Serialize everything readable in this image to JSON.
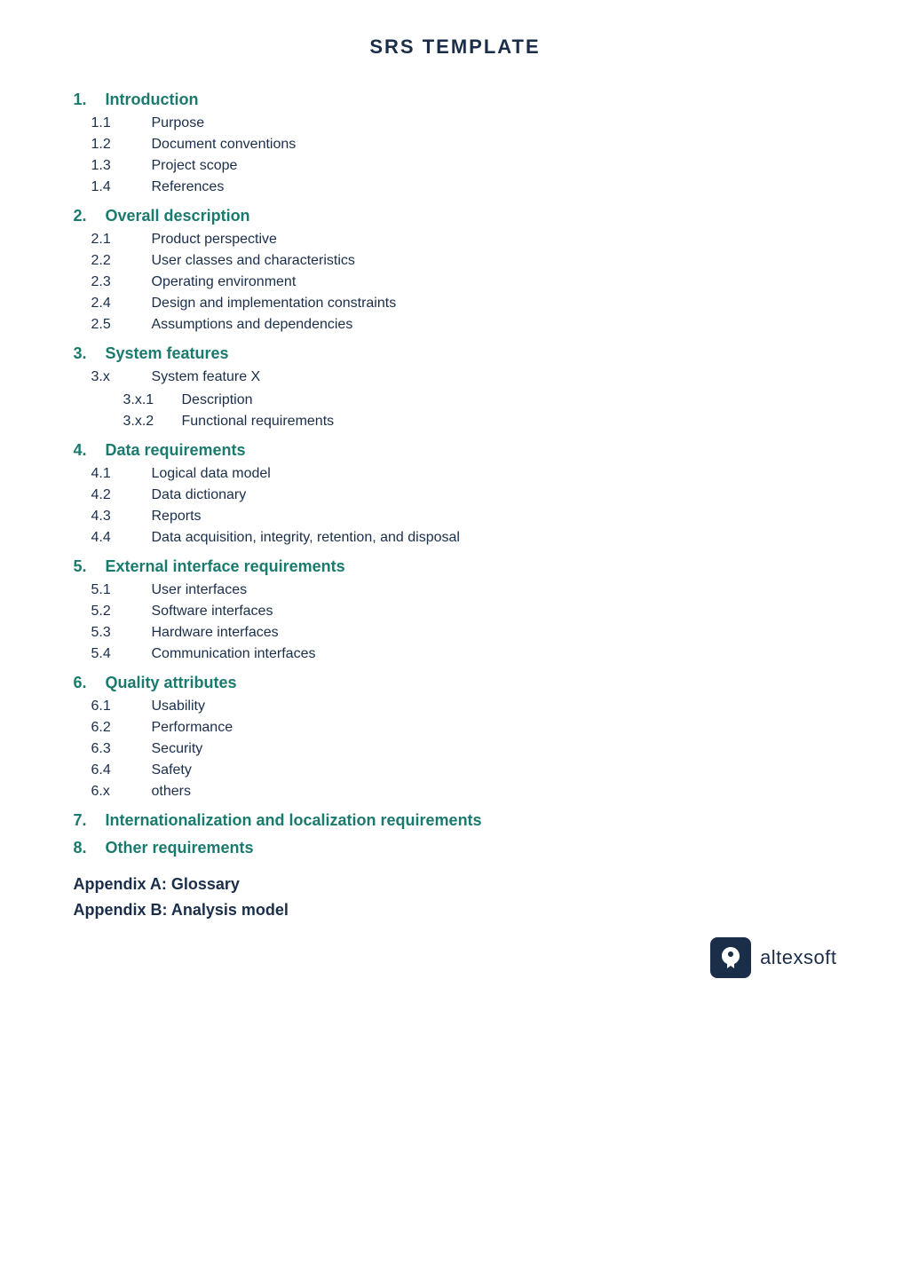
{
  "page": {
    "title": "SRS TEMPLATE"
  },
  "sections": [
    {
      "id": "s1",
      "number": "1.",
      "title": "Introduction",
      "items": [
        {
          "number": "1.1",
          "label": "Purpose"
        },
        {
          "number": "1.2",
          "label": "Document conventions"
        },
        {
          "number": "1.3",
          "label": "Project scope"
        },
        {
          "number": "1.4",
          "label": "References"
        }
      ],
      "subitems": []
    },
    {
      "id": "s2",
      "number": "2.",
      "title": "Overall description",
      "items": [
        {
          "number": "2.1",
          "label": "Product perspective"
        },
        {
          "number": "2.2",
          "label": "User classes and characteristics"
        },
        {
          "number": "2.3",
          "label": "Operating environment"
        },
        {
          "number": "2.4",
          "label": "Design and implementation constraints"
        },
        {
          "number": "2.5",
          "label": "Assumptions and dependencies"
        }
      ],
      "subitems": []
    },
    {
      "id": "s3",
      "number": "3.",
      "title": "System features",
      "items": [
        {
          "number": "3.x",
          "label": "System feature X"
        }
      ],
      "subitems": [
        {
          "number": "3.x.1",
          "label": "Description"
        },
        {
          "number": "3.x.2",
          "label": "Functional requirements"
        }
      ]
    },
    {
      "id": "s4",
      "number": "4.",
      "title": "Data requirements",
      "items": [
        {
          "number": "4.1",
          "label": "Logical data model"
        },
        {
          "number": "4.2",
          "label": "Data dictionary"
        },
        {
          "number": "4.3",
          "label": "Reports"
        },
        {
          "number": "4.4",
          "label": "Data acquisition, integrity, retention, and disposal"
        }
      ],
      "subitems": []
    },
    {
      "id": "s5",
      "number": "5.",
      "title": "External interface requirements",
      "items": [
        {
          "number": "5.1",
          "label": "User interfaces"
        },
        {
          "number": "5.2",
          "label": "Software interfaces"
        },
        {
          "number": "5.3",
          "label": "Hardware interfaces"
        },
        {
          "number": "5.4",
          "label": "Communication interfaces"
        }
      ],
      "subitems": []
    },
    {
      "id": "s6",
      "number": "6.",
      "title": "Quality attributes",
      "items": [
        {
          "number": "6.1",
          "label": "Usability"
        },
        {
          "number": "6.2",
          "label": "Performance"
        },
        {
          "number": "6.3",
          "label": "Security"
        },
        {
          "number": "6.4",
          "label": "Safety"
        },
        {
          "number": "6.x",
          "label": "others"
        }
      ],
      "subitems": []
    },
    {
      "id": "s7",
      "number": "7.",
      "title": "Internationalization and localization requirements",
      "items": [],
      "subitems": []
    },
    {
      "id": "s8",
      "number": "8.",
      "title": "Other requirements",
      "items": [],
      "subitems": []
    }
  ],
  "appendices": [
    {
      "label": "Appendix A: Glossary"
    },
    {
      "label": "Appendix B: Analysis model"
    }
  ],
  "logo": {
    "text": "altexsoft"
  }
}
